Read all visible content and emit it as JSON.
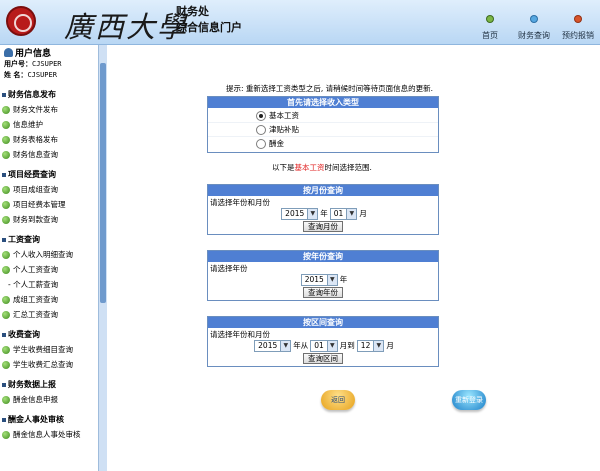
{
  "header": {
    "logo_text": "廣西大學",
    "dept": "财务处",
    "subtitle": "综合信息门户",
    "nav": [
      {
        "label": "首页",
        "icon": "home-icon"
      },
      {
        "label": "财务查询",
        "icon": "query-icon"
      },
      {
        "label": "预约报销",
        "icon": "booking-icon"
      }
    ]
  },
  "sidebar": {
    "user_title": "用户信息",
    "user_id_label": "用户号：",
    "user_id": "CJSUPER",
    "name_label": "姓 名：",
    "name": "CJSUPER",
    "sections": [
      {
        "title": "财务信息发布",
        "items": [
          "财务文件发布",
          "信息维护",
          "财务表格发布",
          "财务信息查询"
        ]
      },
      {
        "title": "项目经费查询",
        "items": [
          "项目成组查询",
          "项目经费本管理",
          "财务到款查询"
        ]
      },
      {
        "title": "工资查询",
        "items": [
          "个人收入明细查询",
          "个人工资查询"
        ],
        "subitem": "- 个人工薪查询",
        "items2": [
          "成组工资查询",
          "汇总工资查询"
        ]
      },
      {
        "title": "收费查询",
        "items": [
          "学生收费细目查询",
          "学生收费汇总查询"
        ]
      },
      {
        "title": "财务数据上报",
        "items": [
          "酬金信息申报"
        ]
      },
      {
        "title": "酬金人事处审核",
        "items": [
          "酬金信息人事处审核"
        ]
      }
    ]
  },
  "main": {
    "hint": "提示: 重新选择工资类型之后, 请稍候时间等待页面信息的更新.",
    "type_panel": {
      "title": "首先请选择收入类型",
      "options": [
        {
          "label": "基本工资",
          "selected": true
        },
        {
          "label": "津贴补贴",
          "selected": false
        },
        {
          "label": "酬金",
          "selected": false
        }
      ]
    },
    "range_note_prefix": "以下是",
    "range_note_type": "基本工资",
    "range_note_suffix": "时间选择范围.",
    "month_panel": {
      "title": "按月份查询",
      "label": "请选择年份和月份",
      "year": "2015",
      "year_unit": "年",
      "month": "01",
      "month_unit": "月",
      "button": "查询月份"
    },
    "year_panel": {
      "title": "按年份查询",
      "label": "请选择年份",
      "year": "2015",
      "year_unit": "年",
      "button": "查询年份"
    },
    "range_panel": {
      "title": "按区间查询",
      "label": "请选择年份和月份",
      "year": "2015",
      "from_label": "年从",
      "from_month": "01",
      "to_label": "月到",
      "to_month": "12",
      "month_unit": "月",
      "button": "查询区间"
    },
    "back_button": "返回",
    "relogin_button": "重新登录"
  }
}
